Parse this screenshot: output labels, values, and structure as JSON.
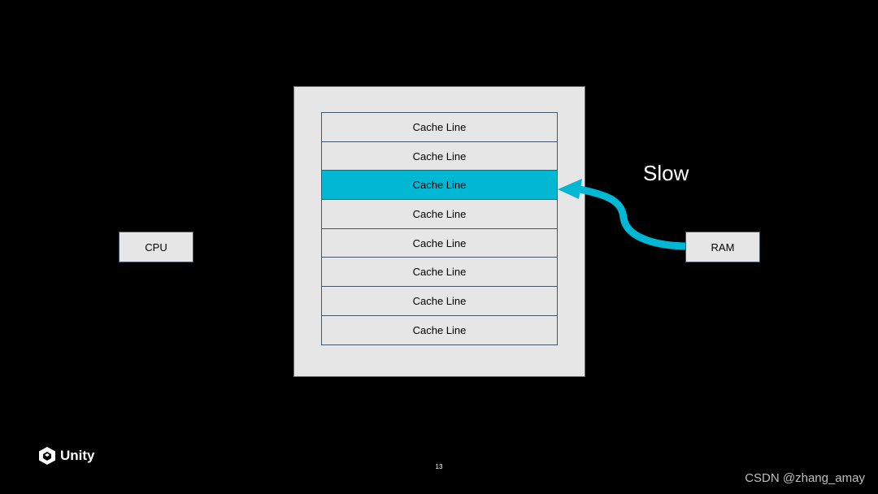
{
  "cpu": {
    "label": "CPU"
  },
  "ram": {
    "label": "RAM"
  },
  "cache": {
    "lines": [
      {
        "label": "Cache Line",
        "highlighted": false
      },
      {
        "label": "Cache Line",
        "highlighted": false
      },
      {
        "label": "Cache Line",
        "highlighted": true
      },
      {
        "label": "Cache Line",
        "highlighted": false
      },
      {
        "label": "Cache Line",
        "highlighted": false
      },
      {
        "label": "Cache Line",
        "highlighted": false
      },
      {
        "label": "Cache Line",
        "highlighted": false
      },
      {
        "label": "Cache Line",
        "highlighted": false
      }
    ],
    "highlight_color": "#00b7d4"
  },
  "arrow": {
    "label": "Slow",
    "from": "RAM",
    "to": "Cache Line 3",
    "color": "#00b7d4"
  },
  "footer": {
    "logo": "Unity",
    "page_number": "13",
    "watermark": "CSDN @zhang_amay"
  }
}
